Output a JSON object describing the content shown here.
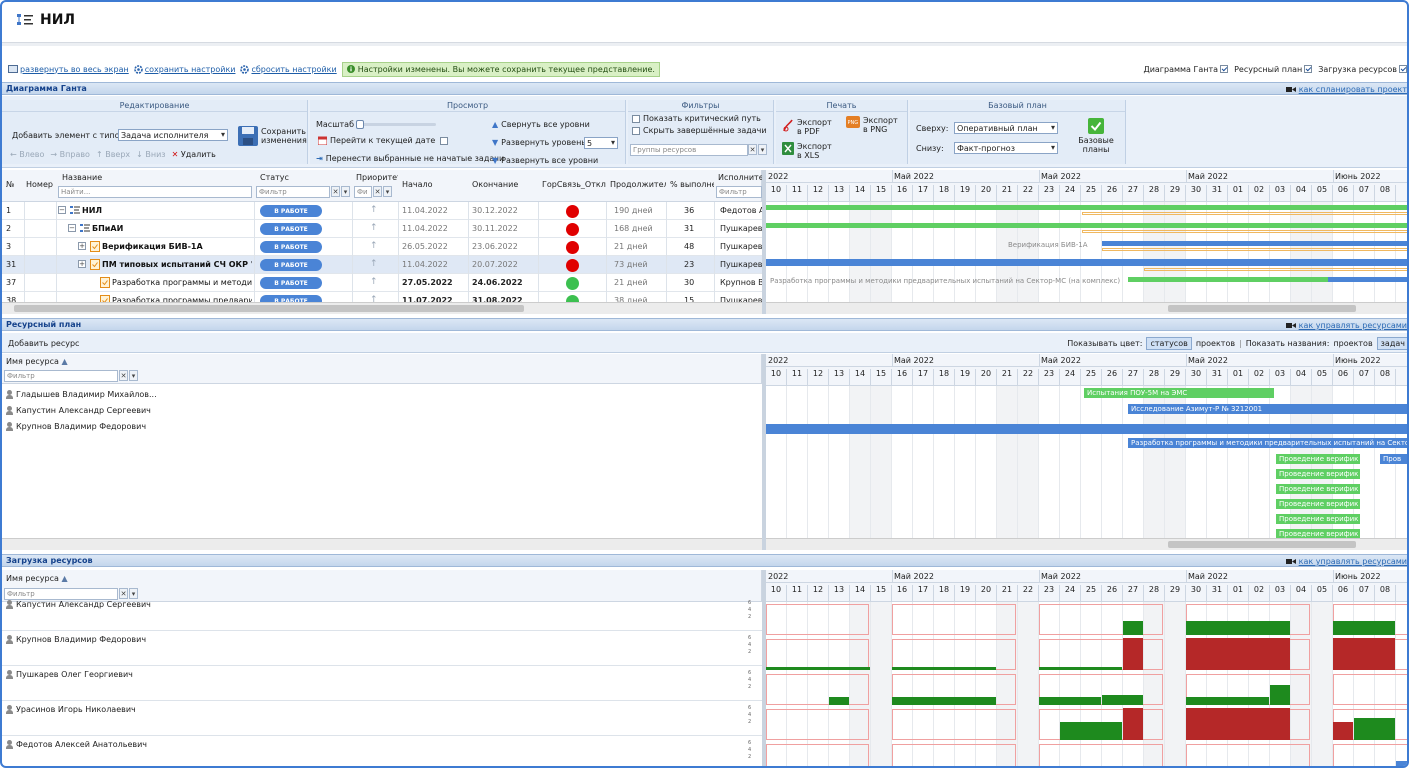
{
  "header": {
    "title": "НИЛ"
  },
  "toolbar": {
    "fullscreen": "развернуть во весь экран",
    "save_settings": "сохранить настройки",
    "reset_settings": "сбросить настройки",
    "notice": "Настройки изменены. Вы можете сохранить текущее представление.",
    "toggles": [
      {
        "label": "Диаграмма Ганта",
        "checked": true
      },
      {
        "label": "Ресурсный план",
        "checked": true
      },
      {
        "label": "Загрузка ресурсов",
        "checked": true
      }
    ]
  },
  "gantt": {
    "section_title": "Диаграмма Ганта",
    "help_link": "как спланировать проект",
    "ribbon": {
      "edit": {
        "title": "Редактирование",
        "add_label": "Добавить элемент с типом",
        "add_type": "Задача исполнителя",
        "save": "Сохранить изменения",
        "left": "Влево",
        "right": "Вправо",
        "up": "Вверх",
        "down": "Вниз",
        "delete": "Удалить"
      },
      "view": {
        "title": "Просмотр",
        "scale": "Масштаб",
        "goto_date": "Перейти к текущей дате",
        "move_tasks": "Перенести выбранные не начатые задачи",
        "collapse_all": "Свернуть все уровни",
        "expand_level": "Развернуть уровень",
        "level_value": "5",
        "expand_all": "Развернуть все уровни"
      },
      "filters": {
        "title": "Фильтры",
        "critical": "Показать критический путь",
        "hide_done": "Скрыть завершённые задачи",
        "groups_placeholder": "Группы ресурсов"
      },
      "print": {
        "title": "Печать",
        "pdf": "Экспорт в PDF",
        "png": "Экспорт в PNG",
        "xls": "Экспорт в XLS"
      },
      "baseline": {
        "title": "Базовый план",
        "top_label": "Сверху:",
        "top_value": "Оперативный план",
        "bottom_label": "Снизу:",
        "bottom_value": "Факт-прогноз",
        "base_plans": "Базовые планы"
      }
    },
    "columns": {
      "num": "№",
      "ver": "Номер в",
      "name": "Название",
      "status": "Статус",
      "priority": "Приоритет",
      "start": "Начало",
      "end": "Окончание",
      "gor": "ГорСвязь_Откл",
      "dur": "Продолжитель",
      "pct": "% выполнен",
      "exec": "Исполнител",
      "find_placeholder": "Найти...",
      "filter_placeholder": "Фильтр",
      "filter_short": "Фи"
    },
    "rows": [
      {
        "num": "1",
        "name": "НИЛ",
        "status": "В РАБОТЕ",
        "start": "11.04.2022",
        "end": "30.12.2022",
        "dur": "190 дней",
        "pct": "36",
        "exec": "Федотов Ал",
        "dot": "#e00000"
      },
      {
        "num": "2",
        "name": "БПиАИ",
        "status": "В РАБОТЕ",
        "start": "11.04.2022",
        "end": "30.11.2022",
        "dur": "168 дней",
        "pct": "31",
        "exec": "Пушкарев С",
        "dot": "#e00000"
      },
      {
        "num": "3",
        "name": "Верификация БИВ-1А",
        "status": "В РАБОТЕ",
        "start": "26.05.2022",
        "end": "23.06.2022",
        "dur": "21 дней",
        "pct": "48",
        "exec": "Пушкарев С",
        "dot": "#e00000"
      },
      {
        "num": "31",
        "name": "ПМ типовых испытаний СЧ ОКР \"М",
        "status": "В РАБОТЕ",
        "start": "11.04.2022",
        "end": "20.07.2022",
        "dur": "73 дней",
        "pct": "23",
        "exec": "Пушкарев С",
        "dot": "#e00000"
      },
      {
        "num": "37",
        "name": "Разработка программы и методики пре",
        "status": "В РАБОТЕ",
        "start": "27.05.2022",
        "end": "24.06.2022",
        "dur": "21 дней",
        "pct": "30",
        "exec": "Крупнов Вл",
        "dot": "#3cc050"
      },
      {
        "num": "38",
        "name": "Разработка программы предварительн",
        "status": "В РАБОТЕ",
        "start": "11.07.2022",
        "end": "31.08.2022",
        "dur": "38 дней",
        "pct": "15",
        "exec": "Пушкарев С",
        "dot": "#3cc050"
      }
    ],
    "timeline": {
      "months": [
        {
          "label": "2022",
          "col": 0
        },
        {
          "label": "Май 2022",
          "col": 6
        },
        {
          "label": "Май 2022",
          "col": 13
        },
        {
          "label": "Май 2022",
          "col": 20
        },
        {
          "label": "Июнь 2022",
          "col": 27
        }
      ],
      "days": [
        "10",
        "11",
        "12",
        "13",
        "14",
        "15",
        "16",
        "17",
        "18",
        "19",
        "20",
        "21",
        "22",
        "23",
        "24",
        "25",
        "26",
        "27",
        "28",
        "29",
        "30",
        "31",
        "01",
        "02",
        "03",
        "04",
        "05",
        "06",
        "07",
        "08"
      ],
      "weekend_cols": [
        4,
        5,
        11,
        12,
        18,
        19,
        25,
        26
      ],
      "labels": [
        "Верификация БИВ-1А",
        "Разработка программы и методики предварительных испытаний на Сектор-МС (на комплекс)"
      ]
    }
  },
  "resource_plan": {
    "section_title": "Ресурсный план",
    "help_link": "как управлять ресурсами",
    "add_resource": "Добавить ресурс",
    "show_color": "Показывать цвет:",
    "color_statuses": "статусов",
    "color_projects": "проектов",
    "show_names": "Показать названия:",
    "names_projects": "проектов",
    "names_tasks": "задач",
    "col_name": "Имя ресурса",
    "filter_placeholder": "Фильтр",
    "people": [
      "Гладышев Владимир Михайлов...",
      "Капустин Александр Сергеевич",
      "Крупнов Владимир Федорович"
    ],
    "bars": [
      "Испытания ПОУ-5М на ЭМС",
      "Исследование Азимут-Р № 3212001",
      "Разработка программы и методики предварительных испытаний на Сектор-МС",
      "Проведение верифик",
      "Пров"
    ]
  },
  "resource_load": {
    "section_title": "Загрузка ресурсов",
    "help_link": "как управлять ресурсами",
    "col_name": "Имя ресурса",
    "filter_placeholder": "Фильтр",
    "people": [
      "Капустин Александр Сергеевич",
      "Крупнов Владимир Федорович",
      "Пушкарев Олег Георгиевич",
      "Урасинов Игорь Николаевич",
      "Федотов Алексей Анатольевич"
    ],
    "axis_ticks": [
      "6",
      "4",
      "2"
    ],
    "colors": {
      "ok": "#1e8a1e",
      "over": "#b52828"
    }
  }
}
